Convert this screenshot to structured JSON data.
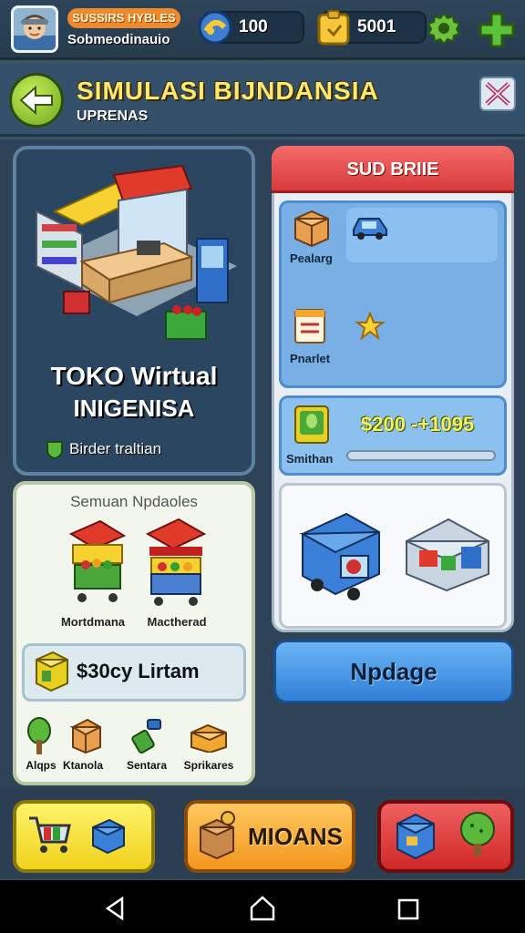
{
  "header": {
    "player_badge": "SUSSIRS HYBLES",
    "player_name": "Sobmeodinauio",
    "coins": "100",
    "cash": "5001"
  },
  "title_bar": {
    "title": "SIMULASI BIJNDANSIA",
    "subtitle": "UPRENAS"
  },
  "shop": {
    "name_line1": "TOKO Wirtual",
    "name_line2": "INIGENISA",
    "tag": "Birder traltian"
  },
  "stalls_panel": {
    "title": "Semuan Npdaoles",
    "stalls": [
      {
        "label": "Mortdmana"
      },
      {
        "label": "Mactherad"
      }
    ],
    "price_label": "$30cy Lirtam",
    "mini_items": [
      {
        "label": "Alqps"
      },
      {
        "label": "Ktanola"
      },
      {
        "label": "Sentara"
      },
      {
        "label": "Sprikares"
      }
    ]
  },
  "side_panel": {
    "title": "SUD BRIIE",
    "items": [
      {
        "label": "Pealarg"
      },
      {
        "label": "Pnarlet"
      }
    ],
    "money_label": "Smithan",
    "money_value": "$200 -+1095",
    "upgrade_button": "Npdage"
  },
  "bottom_bar": {
    "middle_label": "MIOANS"
  },
  "colors": {
    "title_yellow": "#ffe870",
    "panel_red": "#d93b3b",
    "upgrade_blue": "#2f7fd6",
    "accent_green": "#6da81c"
  }
}
